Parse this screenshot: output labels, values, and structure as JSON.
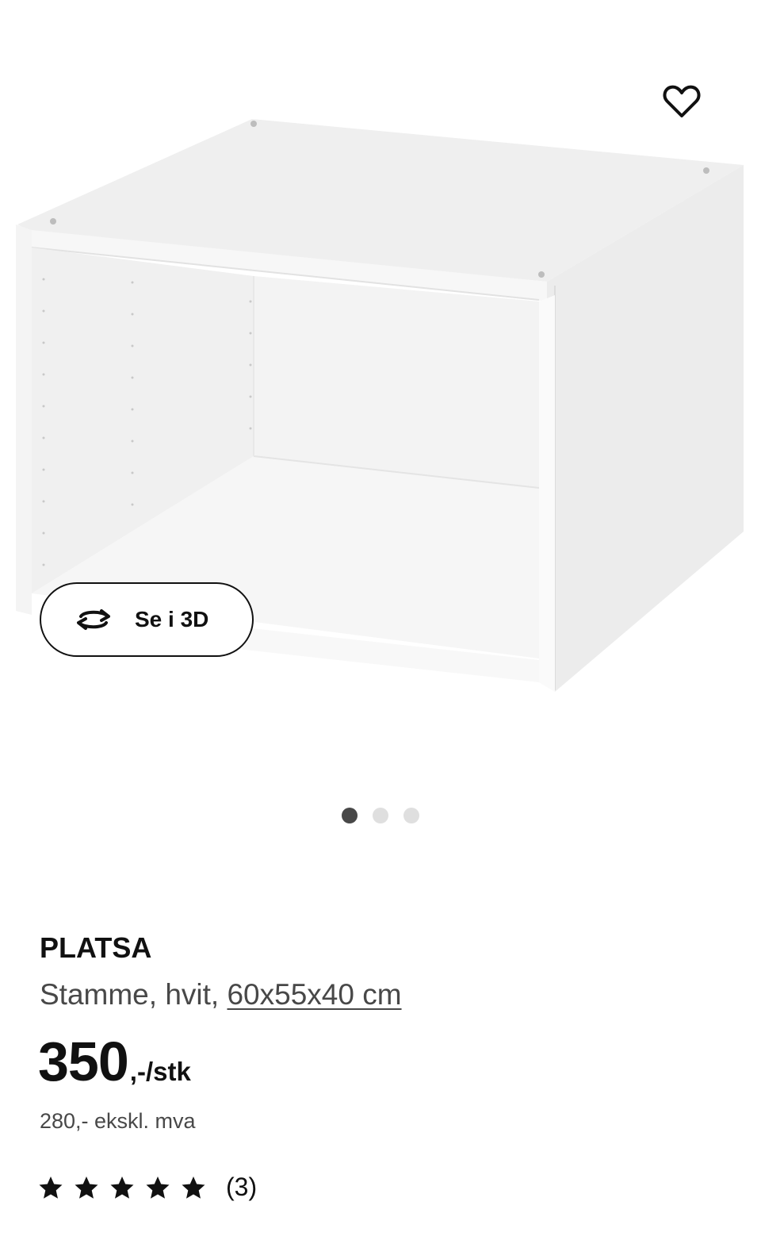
{
  "product": {
    "name": "PLATSA",
    "description": "Stamme, hvit,",
    "size": "60x55x40 cm",
    "price_int": "350",
    "price_suffix": ",-/stk",
    "price_ex_vat": "280,- ekskl. mva",
    "rating_value": 5,
    "rating_max": 5,
    "rating_count": "(3)"
  },
  "gallery": {
    "view_3d_label": "Se i 3D",
    "favorite_icon": "heart-outline-icon",
    "view_3d_icon": "rotate-arrows-icon",
    "slides_total": 3,
    "slide_active": 1
  },
  "colors": {
    "text_primary": "#111111",
    "text_secondary": "#484848",
    "dot_active": "#484848",
    "dot_inactive": "#dfdfdf"
  }
}
